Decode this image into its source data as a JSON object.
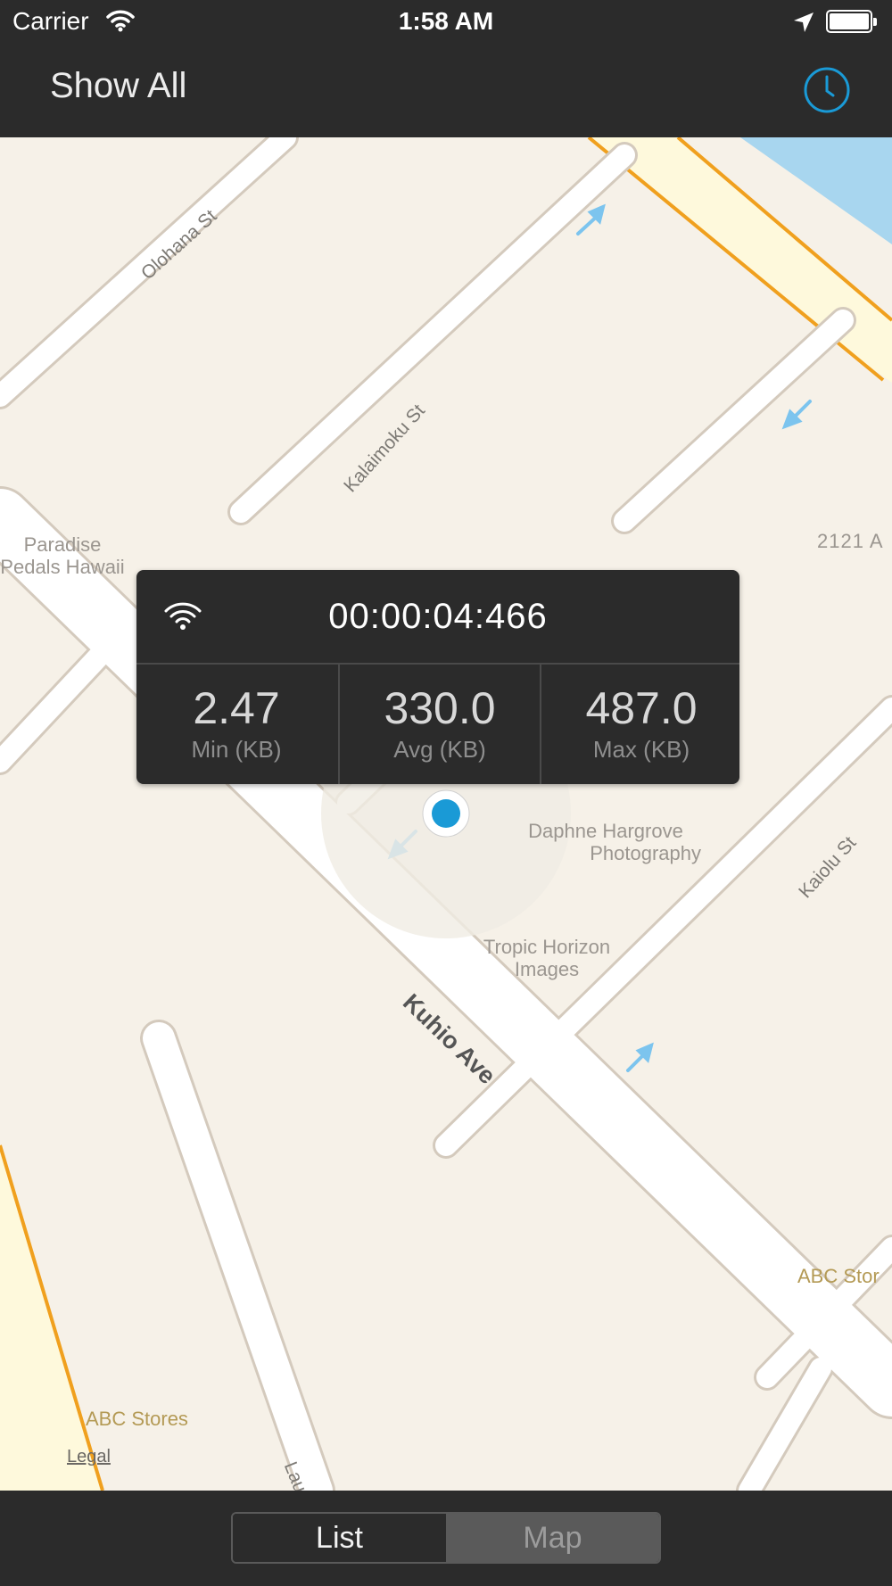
{
  "status_bar": {
    "carrier": "Carrier",
    "time": "1:58 AM"
  },
  "nav": {
    "title": "Show All",
    "history_icon": "clock-icon"
  },
  "map": {
    "streets": [
      "Olohana St",
      "Kalaimoku St",
      "Kuhio Ave",
      "Kaiolu St",
      "Lau"
    ],
    "places": {
      "paradise_line1": "Paradise",
      "paradise_line2": "Pedals Hawaii",
      "address": "2121 A",
      "daphne_line1": "Daphne Hargrove",
      "daphne_line2": "Photography",
      "tropic_line1": "Tropic Horizon",
      "tropic_line2": "Images",
      "abc_right": "ABC Stor",
      "abc_bottom": "ABC Stores"
    },
    "legal": "Legal"
  },
  "popup": {
    "timer": "00:00:04:466",
    "min_value": "2.47",
    "min_label": "Min (KB)",
    "avg_value": "330.0",
    "avg_label": "Avg (KB)",
    "max_value": "487.0",
    "max_label": "Max (KB)"
  },
  "segment": {
    "list_label": "List",
    "map_label": "Map",
    "selected": "Map"
  },
  "colors": {
    "bar": "#2b2b2b",
    "map_bg": "#f6f1e8",
    "accent": "#1a9ad6",
    "road_edge": "#d4cabd",
    "highway": "#f0a01e",
    "water": "#a8d6ef"
  }
}
